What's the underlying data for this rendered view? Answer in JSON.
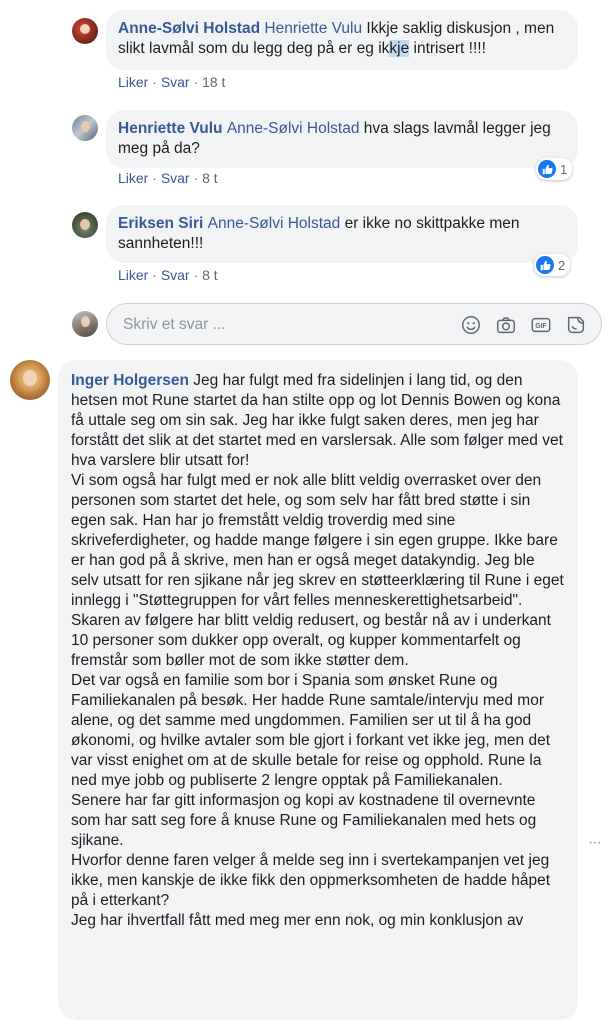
{
  "comments": [
    {
      "author": "Anne-Sølvi Holstad",
      "mention": "Henriette Vulu",
      "text_a": " Ikkje saklig diskusjon , men slikt lavmål som du legg deg på er eg ik",
      "text_hl": "kje",
      "text_b": " intrisert !!!!",
      "like": "Liker",
      "reply": "Svar",
      "time": "18 t"
    },
    {
      "author": "Henriette Vulu",
      "mention": "Anne-Sølvi Holstad",
      "text": " hva slags lavmål legger jeg meg på da?",
      "like": "Liker",
      "reply": "Svar",
      "time": "8 t",
      "reaction_count": "1"
    },
    {
      "author": "Eriksen Siri",
      "mention": "Anne-Sølvi Holstad",
      "text": " er ikke no skittpakke men sannheten!!!",
      "like": "Liker",
      "reply": "Svar",
      "time": "8 t",
      "reaction_count": "2"
    }
  ],
  "composer": {
    "placeholder": "Skriv et svar ...",
    "icons": [
      "emoji-icon",
      "camera-icon",
      "gif-icon",
      "sticker-icon"
    ]
  },
  "main_comment": {
    "author": "Inger Holgersen",
    "paragraphs": [
      " Jeg har fulgt med fra sidelinjen i lang tid, og den hetsen mot Rune startet da han stilte opp og lot Dennis Bowen og kona få uttale seg om sin sak. Jeg har ikke fulgt saken deres, men jeg har forstått det slik at det startet med en varslersak. Alle som følger med vet hva varslere blir utsatt for!",
      "Vi som også har fulgt med er nok alle blitt veldig overrasket over den personen som startet det hele, og som selv har fått bred støtte i sin egen sak. Han har jo fremstått veldig troverdig med sine skriveferdigheter, og hadde mange følgere i sin egen gruppe. Ikke bare er han god på å skrive, men han er også meget datakyndig. Jeg ble selv utsatt for ren sjikane når jeg skrev en støtteerklæring til Rune i eget innlegg i \"Støttegruppen for vårt felles menneskerettighetsarbeid\".",
      "Skaren av følgere har blitt veldig redusert, og består nå av i underkant 10 personer som dukker opp overalt, og kupper kommentarfelt og fremstår som bøller mot de som ikke støtter dem.",
      "Det var også en familie som bor i Spania som ønsket Rune og Familiekanalen på besøk. Her hadde Rune samtale/intervju med mor alene, og det samme med ungdommen. Familien ser ut til å ha god økonomi, og hvilke avtaler som ble gjort i forkant vet ikke jeg, men det var visst enighet om at de skulle betale for reise og opphold. Rune la ned mye jobb og publiserte 2 lengre opptak på Familiekanalen.",
      "Senere har far gitt informasjon og kopi av kostnadene til overnevnte som har satt seg fore å knuse Rune og Familiekanalen med hets og sjikane.",
      "Hvorfor denne faren velger å melde seg inn i svertekampanjen vet jeg ikke, men kanskje de ikke fikk den oppmerksomheten de hadde håpet på i etterkant?",
      "Jeg har ihvertfall fått med meg mer enn nok, og min konklusjon av"
    ],
    "more_glyph": "···"
  }
}
